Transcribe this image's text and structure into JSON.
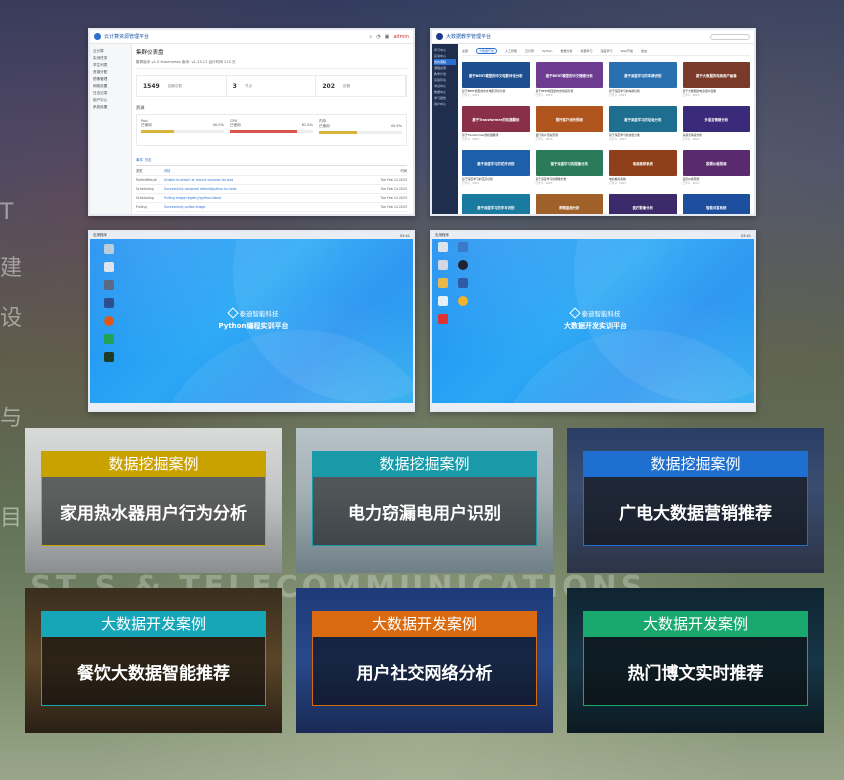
{
  "background": {
    "side_marks": [
      "T",
      "建",
      "设",
      "与",
      "目"
    ],
    "watermark": "ST S & TELECOMMUNICATIONS"
  },
  "shot1": {
    "app_title": "云计算资源管理平台",
    "top_right": "admin",
    "sidebar": [
      "云计算",
      "实训任务",
      "学生列表",
      "资源分配",
      "镜像管理",
      "网络设置",
      "日志记录",
      "用户中心",
      "系统设置"
    ],
    "page_title": "集群仪表盘",
    "info": "集群版本 v1.0   Kubernetes 版本: v1.23.17   运行时间 210 天",
    "stats": [
      {
        "value": "1549",
        "label": "容器总数"
      },
      {
        "value": "3",
        "label": "节点"
      },
      {
        "value": "202",
        "label": "容器"
      }
    ],
    "section": "资源",
    "resources": [
      {
        "name": "Pod",
        "used": "已使用",
        "pct": "40.0%",
        "fill": 0.4,
        "color": "#d9b43a"
      },
      {
        "name": "CPU",
        "used": "已使用",
        "pct": "81.5%",
        "fill": 0.81,
        "color": "#d9534f"
      },
      {
        "name": "内存",
        "used": "已使用",
        "pct": "45.9%",
        "fill": 0.46,
        "color": "#d9b43a"
      }
    ],
    "tab": "事件  日志",
    "rows": [
      {
        "a": "类型",
        "b": "详情",
        "c": "时间"
      },
      {
        "a": "PodInitResult",
        "b": "Unable to attach or mount volumes for pod",
        "c": "Tue Feb 14 2023"
      },
      {
        "a": "Scheduling",
        "b": "Successfully assigned default/python to node",
        "c": "Tue Feb 14 2023"
      },
      {
        "a": "Scheduling",
        "b": "Pulling image registry/python:latest",
        "c": "Tue Feb 14 2023"
      },
      {
        "a": "Pulling",
        "b": "Successfully pulled image",
        "c": "Tue Feb 14 2023"
      }
    ]
  },
  "shot2": {
    "app_title": "大数据教学管理平台",
    "sidebar": [
      "学习中心",
      "实训中心",
      "我的课程",
      "课程资源",
      "教学计划",
      "实验环境",
      "考试中心",
      "数据中心",
      "学习报告",
      "用户中心"
    ],
    "tabs": [
      "全部",
      "大数据开发",
      "人工智能",
      "云计算",
      "Python",
      "数据分析",
      "机器学习",
      "深度学习",
      "Web开发",
      "爬虫"
    ],
    "cards": [
      {
        "title": "基于BERT模型的中文电影评论分析",
        "color": "#1d4f8f"
      },
      {
        "title": "基于BERT模型的中文情感分析",
        "color": "#6d3b8f"
      },
      {
        "title": "基于深度学习的车牌识别",
        "color": "#2a6fb0"
      },
      {
        "title": "基于大数据的电商用户画像",
        "color": "#7a3a2a"
      },
      {
        "title": "基于Transformer的机器翻译",
        "color": "#8a2f4a"
      },
      {
        "title": "银行客户流失预测",
        "color": "#b0541e"
      },
      {
        "title": "基于深度学习的垃圾分类",
        "color": "#1e6f8f"
      },
      {
        "title": "多语言情感分析",
        "color": "#3a2a7a"
      },
      {
        "title": "基于深度学习的花卉识别",
        "color": "#1d5fa8"
      },
      {
        "title": "基于深度学习的图像分类",
        "color": "#2b7a5a"
      },
      {
        "title": "电商推荐系统",
        "color": "#8f3f1a"
      },
      {
        "title": "股票价格预测",
        "color": "#5a2a6f"
      },
      {
        "title": "基于深度学习的手写识别",
        "color": "#1b7aa0"
      },
      {
        "title": "舆情监测分析",
        "color": "#a0602a"
      },
      {
        "title": "医疗影像分析",
        "color": "#3d2a6a"
      },
      {
        "title": "智能问答系统",
        "color": "#1e4f9f"
      }
    ],
    "card_meta": "已学习 · 2023"
  },
  "shot3": {
    "app_menu": "应用程序",
    "clock": "03:41",
    "brand": "泰迪智能科技",
    "platform": "Python编程实训平台"
  },
  "shot4": {
    "app_menu": "应用程序",
    "clock": "03:41",
    "brand": "泰迪智能科技",
    "platform": "大数据开发实训平台"
  },
  "cases": [
    {
      "tag": "数据挖掘案例",
      "title": "家用热水器用户行为分析",
      "tag_color": "#c9a200",
      "border": "#c9a200"
    },
    {
      "tag": "数据挖掘案例",
      "title": "电力窃漏电用户识别",
      "tag_color": "#1a9aa8",
      "border": "#1a9aa8"
    },
    {
      "tag": "数据挖掘案例",
      "title": "广电大数据营销推荐",
      "tag_color": "#1f6fd0",
      "border": "#1f6fd0"
    },
    {
      "tag": "大数据开发案例",
      "title": "餐饮大数据智能推荐",
      "tag_color": "#17a5b8",
      "border": "#17a5b8"
    },
    {
      "tag": "大数据开发案例",
      "title": "用户社交网络分析",
      "tag_color": "#d96a10",
      "border": "#d96a10"
    },
    {
      "tag": "大数据开发案例",
      "title": "热门博文实时推荐",
      "tag_color": "#19a86e",
      "border": "#19a86e"
    }
  ]
}
